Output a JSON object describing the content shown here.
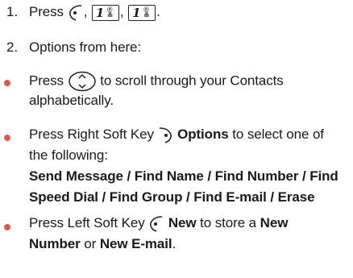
{
  "steps": [
    {
      "number": "1.",
      "press": "Press",
      "comma1": ",",
      "comma2": ",",
      "period": ".",
      "key_label": "1",
      "key_symbol_top": "®",
      "key_symbol_bottom": "≗"
    },
    {
      "number": "2.",
      "text": "Options from here:"
    }
  ],
  "bullets": {
    "b1": {
      "before": "Press",
      "after": "to scroll through your Contacts",
      "line2": "alphabetically."
    },
    "b2": {
      "lead": "Press Right Soft Key",
      "option_word": "Options",
      "tail": "to select one of",
      "line2": "the following:",
      "options_line1": "Send Message / Find Name / Find Number / Find",
      "options_line2": "Speed Dial / Find Group / Find E-mail / Erase"
    },
    "b3": {
      "lead": "Press Left Soft Key",
      "new_word": "New",
      "tail": "to store a",
      "new_word2": "New",
      "number_word": "Number",
      "or_word": "or",
      "email_word": "New E-mail",
      "period": "."
    }
  },
  "icons": {
    "left_soft_key": "left-soft-key-icon",
    "right_soft_key": "right-soft-key-icon",
    "nav_key": "navigation-key-icon",
    "key_1": "key-1-icon"
  },
  "colors": {
    "bullet": "#e2574c",
    "text": "#1a1a1a"
  }
}
